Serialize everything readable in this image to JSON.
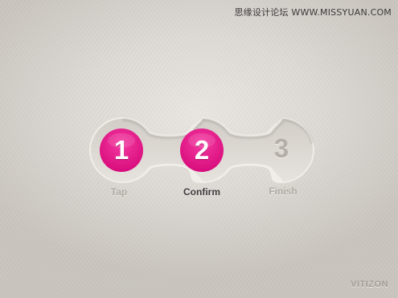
{
  "watermark": "思缘设计论坛 WWW.MISSYUAN.COM",
  "stepper": {
    "accent_color": "#e5138a",
    "steps": [
      {
        "number": "1",
        "label": "Tap",
        "state": "done"
      },
      {
        "number": "2",
        "label": "Confirm",
        "state": "active"
      },
      {
        "number": "3",
        "label": "Finish",
        "state": "upcoming"
      }
    ]
  },
  "brand": "VITIZON"
}
